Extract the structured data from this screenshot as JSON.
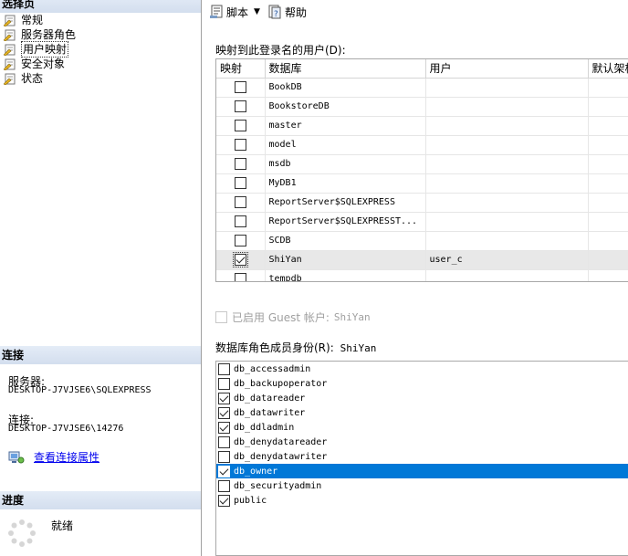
{
  "left": {
    "select_page": {
      "title": "选择页",
      "items": [
        {
          "label": "常规",
          "selected": false
        },
        {
          "label": "服务器角色",
          "selected": false
        },
        {
          "label": "用户映射",
          "selected": true
        },
        {
          "label": "安全对象",
          "selected": false
        },
        {
          "label": "状态",
          "selected": false
        }
      ]
    },
    "connection": {
      "title": "连接",
      "server_label": "服务器:",
      "server_value": "DESKTOP-J7VJSE6\\SQLEXPRESS",
      "conn_label": "连接:",
      "conn_value": "DESKTOP-J7VJSE6\\14276",
      "view_props_link": "查看连接属性"
    },
    "progress": {
      "title": "进度",
      "status": "就绪"
    }
  },
  "toolbar": {
    "script_label": "脚本",
    "help_label": "帮助"
  },
  "mapping": {
    "label": "映射到此登录名的用户(D):",
    "columns": [
      "映射",
      "数据库",
      "用户",
      "默认架构"
    ],
    "rows": [
      {
        "map": false,
        "db": "BookDB",
        "user": ""
      },
      {
        "map": false,
        "db": "BookstoreDB",
        "user": ""
      },
      {
        "map": false,
        "db": "master",
        "user": ""
      },
      {
        "map": false,
        "db": "model",
        "user": ""
      },
      {
        "map": false,
        "db": "msdb",
        "user": ""
      },
      {
        "map": false,
        "db": "MyDB1",
        "user": ""
      },
      {
        "map": false,
        "db": "ReportServer$SQLEXPRESS",
        "user": ""
      },
      {
        "map": false,
        "db": "ReportServer$SQLEXPRESST...",
        "user": ""
      },
      {
        "map": false,
        "db": "SCDB",
        "user": ""
      },
      {
        "map": true,
        "db": "ShiYan",
        "user": "user_c",
        "selected": true
      },
      {
        "map": false,
        "db": "tempdb",
        "user": ""
      }
    ]
  },
  "guest": {
    "label": "已启用 Guest 帐户:",
    "db": "ShiYan",
    "checked": false
  },
  "roles": {
    "label": "数据库角色成员身份(R):",
    "db": "ShiYan",
    "items": [
      {
        "name": "db_accessadmin",
        "checked": false
      },
      {
        "name": "db_backupoperator",
        "checked": false
      },
      {
        "name": "db_datareader",
        "checked": true
      },
      {
        "name": "db_datawriter",
        "checked": true
      },
      {
        "name": "db_ddladmin",
        "checked": true
      },
      {
        "name": "db_denydatareader",
        "checked": false
      },
      {
        "name": "db_denydatawriter",
        "checked": false
      },
      {
        "name": "db_owner",
        "checked": true,
        "selected": true
      },
      {
        "name": "db_securityadmin",
        "checked": false
      },
      {
        "name": "public",
        "checked": true
      }
    ]
  },
  "colors": {
    "selection_blue": "#0078d7",
    "header_gradient": "#d3deee",
    "link": "#0000ee"
  }
}
